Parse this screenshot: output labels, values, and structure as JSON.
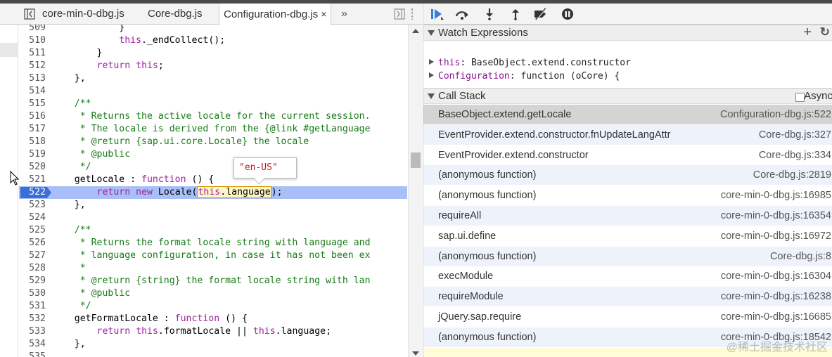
{
  "tabs": [
    {
      "label": "core-min-0-dbg.js"
    },
    {
      "label": "Core-dbg.js"
    },
    {
      "label": "Configuration-dbg.js",
      "active": true
    }
  ],
  "tab_close_glyph": "×",
  "tab_overflow_glyph": "»",
  "code_lines": [
    {
      "num": "509",
      "text": "            }"
    },
    {
      "num": "510",
      "text": "            this._endCollect();"
    },
    {
      "num": "511",
      "text": "        }"
    },
    {
      "num": "512",
      "text": "        return this;"
    },
    {
      "num": "513",
      "text": "    },"
    },
    {
      "num": "514",
      "text": ""
    },
    {
      "num": "515",
      "text": "    /**"
    },
    {
      "num": "516",
      "text": "     * Returns the active locale for the current session."
    },
    {
      "num": "517",
      "text": "     * The locale is derived from the {@link #getLanguage"
    },
    {
      "num": "518",
      "text": "     * @return {sap.ui.core.Locale} the locale"
    },
    {
      "num": "519",
      "text": "     * @public"
    },
    {
      "num": "520",
      "text": "     */"
    },
    {
      "num": "521",
      "text": "    getLocale : function () {"
    },
    {
      "num": "522",
      "text": "        return new Locale(this.language);"
    },
    {
      "num": "523",
      "text": "    },"
    },
    {
      "num": "524",
      "text": ""
    },
    {
      "num": "525",
      "text": "    /**"
    },
    {
      "num": "526",
      "text": "     * Returns the format locale string with language and"
    },
    {
      "num": "527",
      "text": "     * language configuration, in case it has not been ex"
    },
    {
      "num": "528",
      "text": "     *"
    },
    {
      "num": "529",
      "text": "     * @return {string} the format locale string with lan"
    },
    {
      "num": "530",
      "text": "     * @public"
    },
    {
      "num": "531",
      "text": "     */"
    },
    {
      "num": "532",
      "text": "    getFormatLocale : function () {"
    },
    {
      "num": "533",
      "text": "        return this.formatLocale || this.language;"
    },
    {
      "num": "534",
      "text": "    },"
    },
    {
      "num": "535",
      "text": ""
    }
  ],
  "active_line": "522",
  "popover_value": "\"en-US\"",
  "watch": {
    "title": "Watch Expressions",
    "add_glyph": "+",
    "refresh_glyph": "↻",
    "items": [
      {
        "key": "this",
        "value": "BaseObject.extend.constructor"
      },
      {
        "key": "Configuration",
        "value": "function (oCore) {"
      }
    ]
  },
  "callstack": {
    "title": "Call Stack",
    "async_label": "Async",
    "frames": [
      {
        "fn": "BaseObject.extend.getLocale",
        "loc": "Configuration-dbg.js:522"
      },
      {
        "fn": "EventProvider.extend.constructor.fnUpdateLangAttr",
        "loc": "Core-dbg.js:327"
      },
      {
        "fn": "EventProvider.extend.constructor",
        "loc": "Core-dbg.js:334"
      },
      {
        "fn": "(anonymous function)",
        "loc": "Core-dbg.js:2819"
      },
      {
        "fn": "(anonymous function)",
        "loc": "core-min-0-dbg.js:16985"
      },
      {
        "fn": "requireAll",
        "loc": "core-min-0-dbg.js:16354"
      },
      {
        "fn": "sap.ui.define",
        "loc": "core-min-0-dbg.js:16972"
      },
      {
        "fn": "(anonymous function)",
        "loc": "Core-dbg.js:8"
      },
      {
        "fn": "execModule",
        "loc": "core-min-0-dbg.js:16304"
      },
      {
        "fn": "requireModule",
        "loc": "core-min-0-dbg.js:16238"
      },
      {
        "fn": "jQuery.sap.require",
        "loc": "core-min-0-dbg.js:16685"
      },
      {
        "fn": "(anonymous function)",
        "loc": "core-min-0-dbg.js:18542"
      }
    ]
  },
  "watermark": "@稀土掘金技术社区",
  "colors": {
    "keyword": "#a020a0",
    "comment": "#177b17",
    "active_line": "#a8bff7",
    "breakpoint": "#3a6fd8",
    "string": "#c41a16"
  }
}
